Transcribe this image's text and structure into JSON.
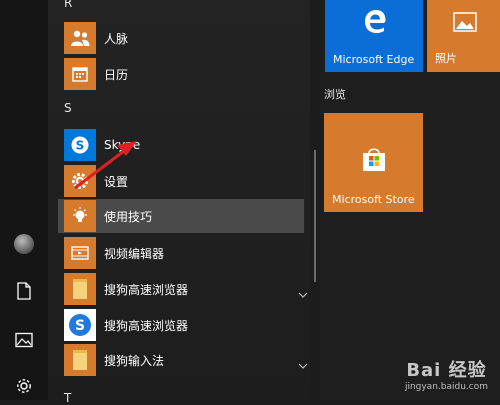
{
  "colors": {
    "accent": "#d67a2e",
    "edge": "#0b6dd6",
    "skype": "#0078d7",
    "sogou_blue": "#1f7ae0"
  },
  "app_list": {
    "groups": [
      {
        "letter": "R",
        "apps": [
          {
            "label": "人脉",
            "icon": "people-icon"
          },
          {
            "label": "日历",
            "icon": "calendar-icon"
          }
        ]
      },
      {
        "letter": "S",
        "apps": [
          {
            "label": "Skype",
            "icon": "skype-icon"
          },
          {
            "label": "设置",
            "icon": "gear-icon"
          },
          {
            "label": "使用技巧",
            "icon": "lightbulb-icon"
          },
          {
            "label": "视频编辑器",
            "icon": "video-icon"
          },
          {
            "label": "搜狗高速浏览器",
            "icon": "folder-icon"
          },
          {
            "label": "搜狗高速浏览器",
            "icon": "sogou-icon"
          },
          {
            "label": "搜狗输入法",
            "icon": "folder-icon"
          }
        ]
      },
      {
        "letter": "T",
        "apps": []
      }
    ]
  },
  "tiles": {
    "edge": "Microsoft Edge",
    "photos": "照片",
    "group_browse": "浏览",
    "store": "Microsoft Store"
  },
  "watermark": {
    "top": "Bai 经验",
    "bottom": "jingyan.baidu.com"
  }
}
